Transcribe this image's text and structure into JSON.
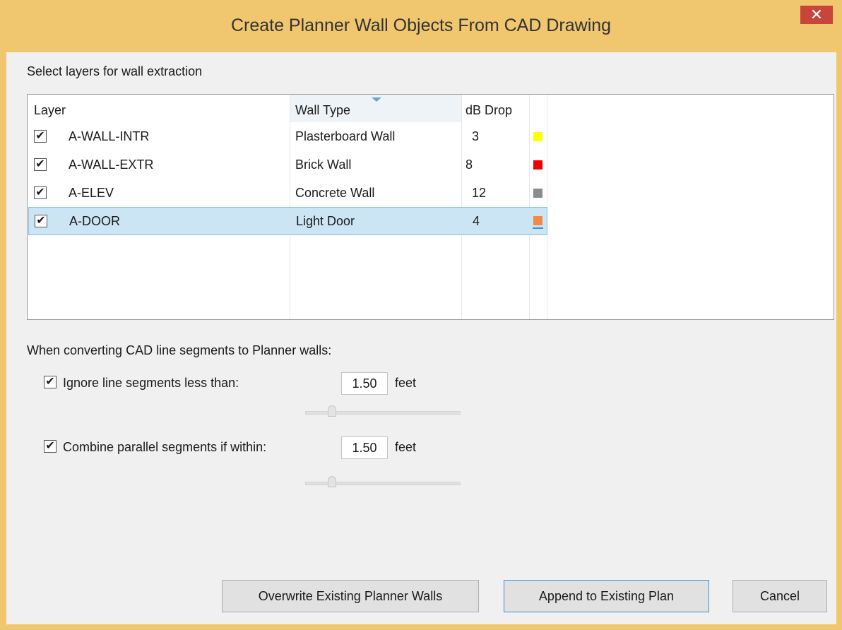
{
  "window": {
    "title": "Create Planner Wall Objects From CAD Drawing",
    "close_glyph": "✕"
  },
  "layers": {
    "label": "Select layers for wall extraction",
    "columns": [
      "Layer",
      "Wall Type",
      "dB Drop"
    ],
    "rows": [
      {
        "checked": true,
        "layer": "A-WALL-INTR",
        "wall_type": "Plasterboard Wall",
        "db_drop": "3",
        "color": "#ffff00"
      },
      {
        "checked": true,
        "layer": "A-WALL-EXTR",
        "wall_type": "Brick Wall",
        "db_drop": "8",
        "color": "#ee0000"
      },
      {
        "checked": true,
        "layer": "A-ELEV",
        "wall_type": "Concrete Wall",
        "db_drop": "12",
        "color": "#8c8c8c"
      },
      {
        "checked": true,
        "layer": "A-DOOR",
        "wall_type": "Light Door",
        "db_drop": "4",
        "color": "#f08a4b",
        "selected": true
      }
    ]
  },
  "conversion": {
    "label": "When converting CAD line segments to Planner walls:",
    "ignore": {
      "checked": true,
      "label": "Ignore line segments less than:",
      "value": "1.50",
      "unit": "feet"
    },
    "combine": {
      "checked": true,
      "label": "Combine parallel segments if within:",
      "value": "1.50",
      "unit": "feet"
    }
  },
  "buttons": {
    "overwrite": "Overwrite Existing Planner Walls",
    "append": "Append to Existing Plan",
    "cancel": "Cancel"
  },
  "check_glyph": "✔",
  "colors": {
    "title_bar": "#f0c66e",
    "close_button": "#c9453b",
    "selected_row": "#cce5f4",
    "default_button_border": "#3c8fd8"
  }
}
